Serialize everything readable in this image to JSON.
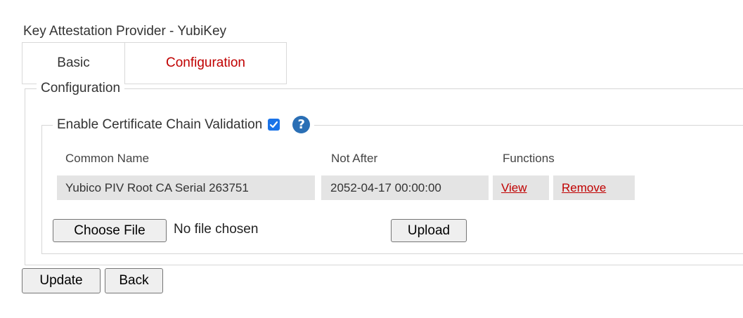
{
  "page": {
    "title": "Key Attestation Provider - YubiKey"
  },
  "tabs": [
    {
      "label": "Basic",
      "active": false
    },
    {
      "label": "Configuration",
      "active": true
    }
  ],
  "configuration": {
    "legend": "Configuration",
    "chain_validation": {
      "label": "Enable Certificate Chain Validation",
      "checked": true,
      "help_glyph": "?"
    },
    "table": {
      "headers": [
        "Common Name",
        "Not After",
        "Functions"
      ],
      "rows": [
        {
          "common_name": "Yubico PIV Root CA Serial 263751",
          "not_after": "2052-04-17 00:00:00",
          "actions": [
            "View",
            "Remove"
          ]
        }
      ]
    },
    "file_input": {
      "button_label": "Choose File",
      "status": "No file chosen"
    },
    "upload_label": "Upload"
  },
  "actions": {
    "update_label": "Update",
    "back_label": "Back"
  },
  "colors": {
    "active_tab": "#c00000",
    "link": "#c00000",
    "checkbox": "#1a73e8",
    "help_icon": "#2a6fb5",
    "row_bg": "#e4e4e4"
  },
  "icons": {
    "checkbox": "checkmark-icon",
    "help": "help-icon"
  }
}
